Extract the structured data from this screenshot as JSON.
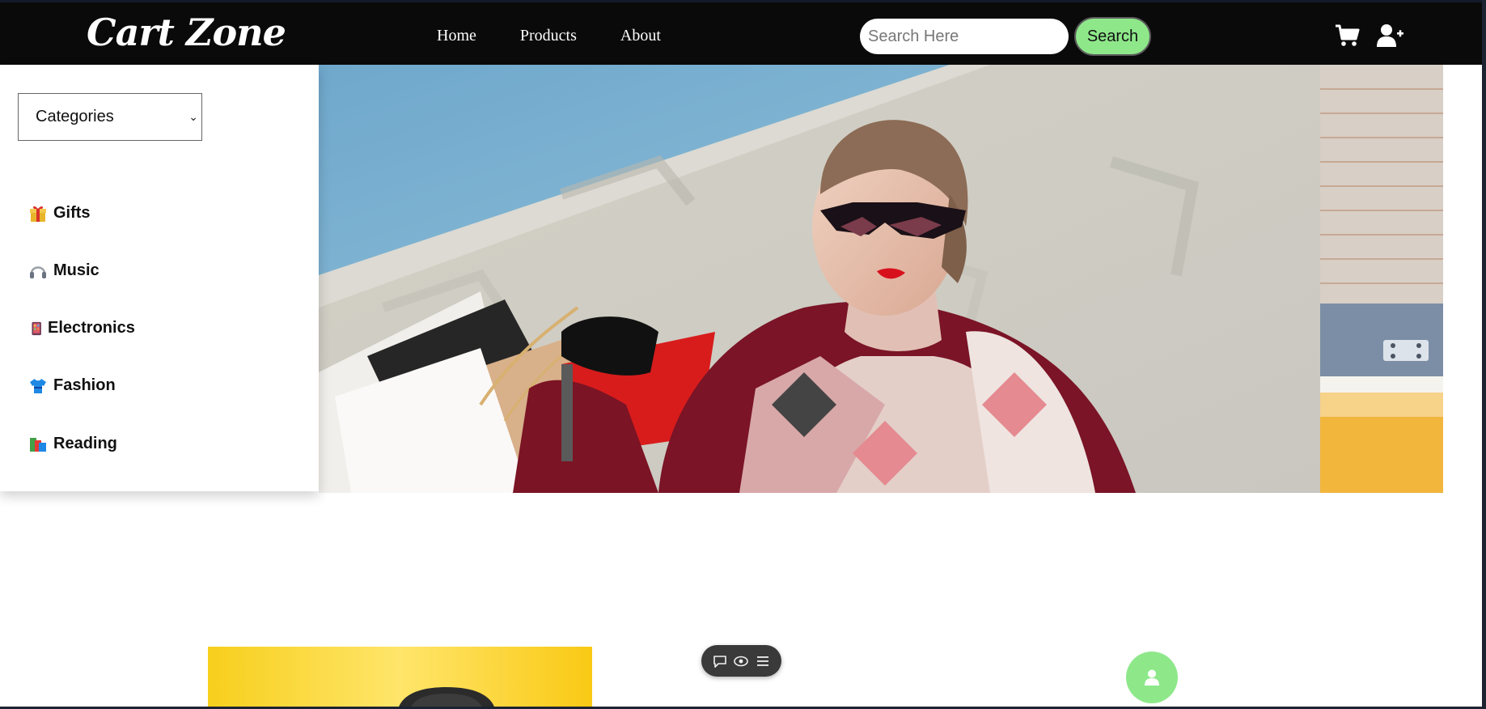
{
  "brand": {
    "name": "Cart Zone"
  },
  "nav": {
    "links": [
      {
        "label": "Home"
      },
      {
        "label": "Products"
      },
      {
        "label": "About"
      }
    ]
  },
  "search": {
    "placeholder": "Search Here",
    "value": "",
    "button_label": "Search"
  },
  "header_icons": {
    "cart": "cart-icon",
    "account": "user-plus-icon"
  },
  "sidebar": {
    "select_label": "Categories",
    "items": [
      {
        "label": "Gifts",
        "icon": "gift-icon"
      },
      {
        "label": "Music",
        "icon": "headphones-icon"
      },
      {
        "label": "Electronics",
        "icon": "mobile-phone-icon"
      },
      {
        "label": "Fashion",
        "icon": "tshirt-icon"
      },
      {
        "label": "Reading",
        "icon": "books-icon"
      }
    ]
  },
  "colors": {
    "navbar": "#0a0a0a",
    "accent_green": "#8ee88a",
    "text_white": "#ffffff"
  },
  "floating": {
    "toolbar_icons": [
      "chat-icon",
      "eye-icon",
      "menu-icon"
    ],
    "profile_icon": "user-icon"
  }
}
